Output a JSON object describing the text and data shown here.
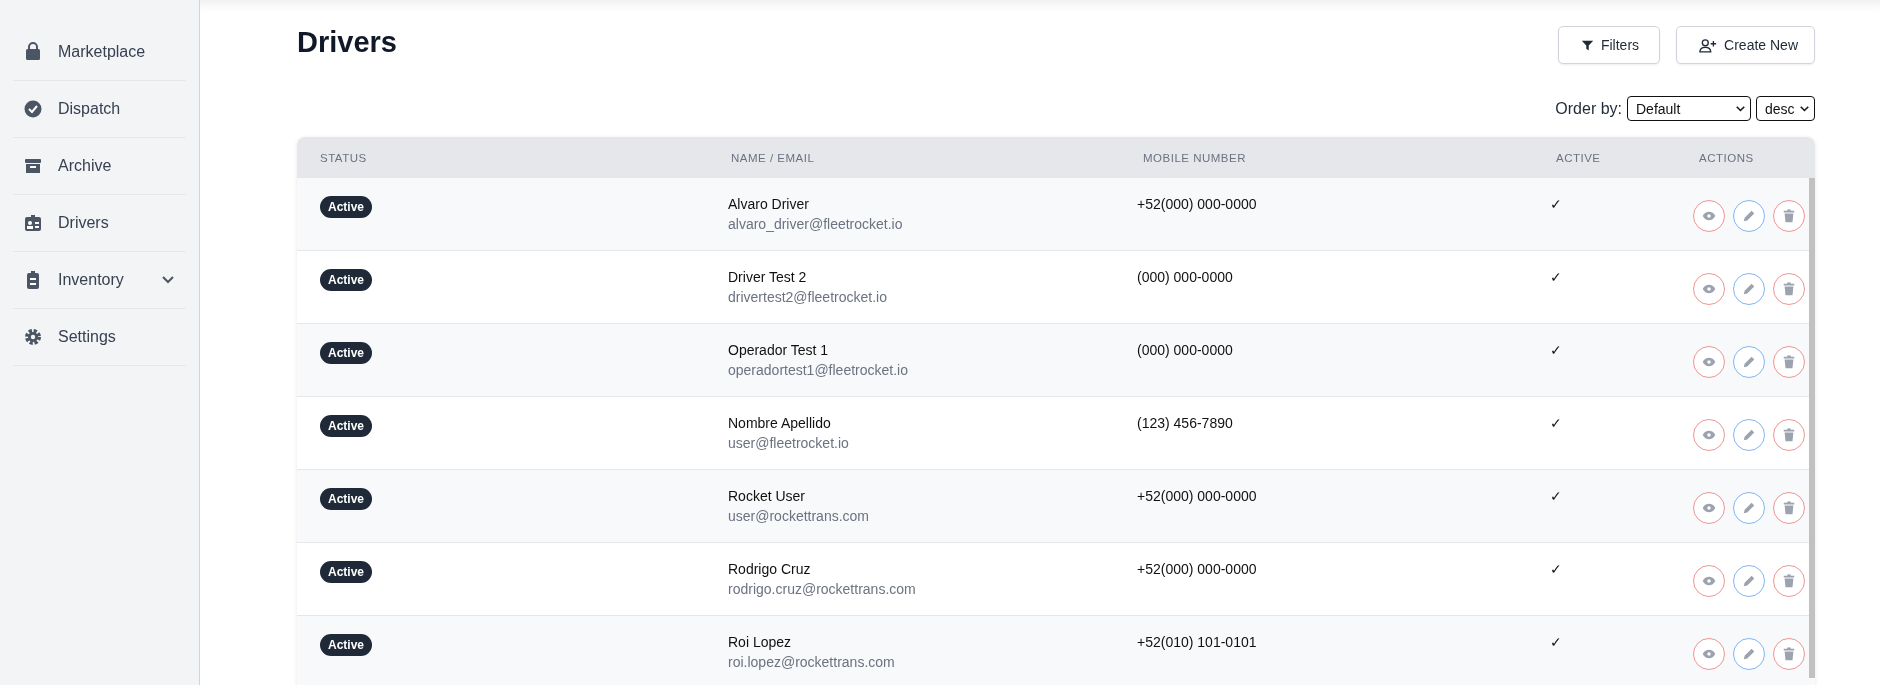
{
  "sidebar": {
    "items": [
      {
        "label": "Marketplace",
        "expandable": false
      },
      {
        "label": "Dispatch",
        "expandable": false
      },
      {
        "label": "Archive",
        "expandable": false
      },
      {
        "label": "Drivers",
        "expandable": false
      },
      {
        "label": "Inventory",
        "expandable": true
      },
      {
        "label": "Settings",
        "expandable": false
      }
    ]
  },
  "page": {
    "title": "Drivers",
    "buttons": [
      {
        "label": "Filters"
      },
      {
        "label": "Create New"
      }
    ],
    "order_by": {
      "label": "Order by:",
      "field": "Default",
      "direction": "desc"
    }
  },
  "table": {
    "columns": [
      "STATUS",
      "NAME / EMAIL",
      "MOBILE NUMBER",
      "ACTIVE",
      "ACTIONS"
    ],
    "rows": [
      {
        "status": "Active",
        "name": "Alvaro Driver",
        "email": "alvaro_driver@fleetrocket.io",
        "mobile": "+52(000) 000-0000",
        "active": "✓"
      },
      {
        "status": "Active",
        "name": "Driver Test 2",
        "email": "drivertest2@fleetrocket.io",
        "mobile": "(000) 000-0000",
        "active": "✓"
      },
      {
        "status": "Active",
        "name": "Operador Test 1",
        "email": "operadortest1@fleetrocket.io",
        "mobile": "(000) 000-0000",
        "active": "✓"
      },
      {
        "status": "Active",
        "name": "Nombre Apellido",
        "email": "user@fleetrocket.io",
        "mobile": "(123) 456-7890",
        "active": "✓"
      },
      {
        "status": "Active",
        "name": "Rocket User",
        "email": "user@rockettrans.com",
        "mobile": "+52(000) 000-0000",
        "active": "✓"
      },
      {
        "status": "Active",
        "name": "Rodrigo Cruz",
        "email": "rodrigo.cruz@rockettrans.com",
        "mobile": "+52(000) 000-0000",
        "active": "✓"
      },
      {
        "status": "Active",
        "name": "Roi Lopez",
        "email": "roi.lopez@rockettrans.com",
        "mobile": "+52(010) 101-0101",
        "active": "✓"
      }
    ]
  }
}
